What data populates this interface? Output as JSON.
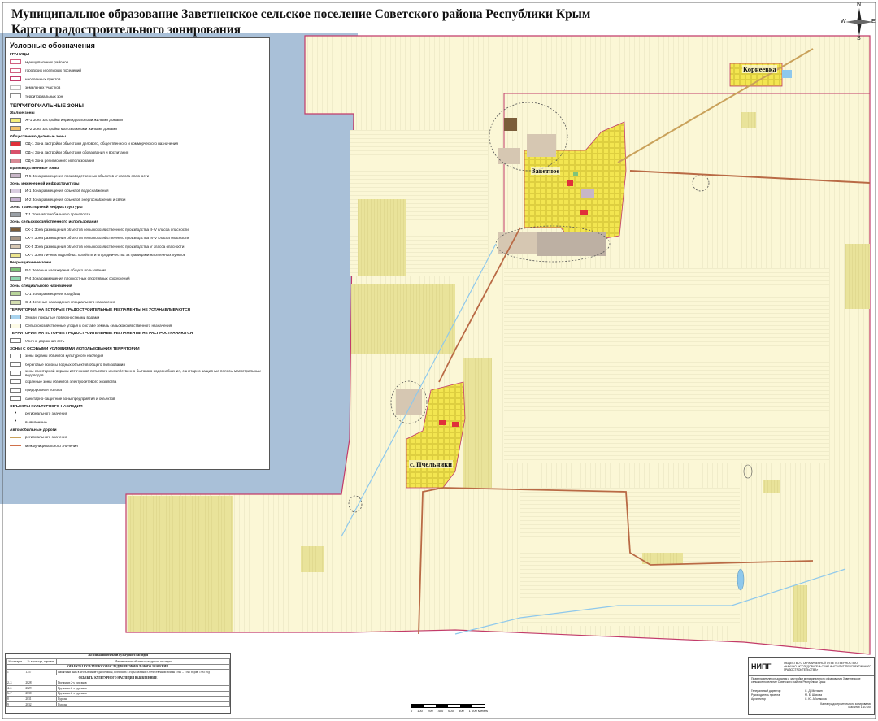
{
  "title": {
    "line1": "Муниципальное образование Заветненское сельское поселение Советского района Республики Крым",
    "line2": "Карта градостроительного зонирования"
  },
  "compass": {
    "n": "N",
    "e": "E",
    "s": "S",
    "w": "W"
  },
  "places": {
    "zavetnoe": "Заветное",
    "pchelniki": "с. Пчельники",
    "korneevka": "Корнеевка"
  },
  "legend": {
    "heading": "Условные обозначения",
    "borders_title": "ГРАНИЦЫ",
    "borders": [
      {
        "label": "муниципальных районов",
        "color": "#d06080"
      },
      {
        "label": "городских и сельских поселений",
        "color": "#d06080"
      },
      {
        "label": "населенных пунктов",
        "color": "#c23b6a"
      },
      {
        "label": "земельных участков",
        "color": "#bbbbbb"
      },
      {
        "label": "территориальных зон",
        "color": "#888888"
      }
    ],
    "terr_zones_title": "ТЕРРИТОРИАЛЬНЫЕ ЗОНЫ",
    "residential_title": "Жилые зоны",
    "residential": [
      {
        "label": "Ж-1  Зона застройки индивидуальными жилыми домами",
        "color": "#f6ef7a"
      },
      {
        "label": "Ж-2  Зона застройки малоэтажными жилыми домами",
        "color": "#f3c36b"
      }
    ],
    "public_title": "Общественно-деловые зоны",
    "public": [
      {
        "label": "ОД-1  Зона застройки объектами делового, общественного и коммерческого назначения",
        "color": "#e0303a"
      },
      {
        "label": "ОД-4  Зона застройки объектами образования и воспитания",
        "color": "#d9506a"
      },
      {
        "label": "ОД-6  Зона религиозного использования",
        "color": "#d88a95"
      }
    ],
    "industrial_title": "Производственные зоны",
    "industrial": [
      {
        "label": "П-5  Зона размещения производственных объектов V класса опасности",
        "color": "#c7b6c7"
      }
    ],
    "engineering_title": "Зоны инженерной инфраструктуры",
    "engineering": [
      {
        "label": "И-1  Зона размещения объектов водоснабжения",
        "color": "#d9cde0"
      },
      {
        "label": "И-2  Зона размещения объектов энергоснабжения и связи",
        "color": "#c8b4d2"
      }
    ],
    "transport_title": "Зоны транспортной инфраструктуры",
    "transport": [
      {
        "label": "Т-1  Зона автомобильного транспорта",
        "color": "#9aa0a6"
      }
    ],
    "agri_title": "Зоны сельскохозяйственного использования",
    "agri": [
      {
        "label": "СХ-2  Зона размещения объектов сельскохозяйственного производства II- V класса опасности",
        "color": "#7b5d3a"
      },
      {
        "label": "СХ-4  Зона размещения объектов сельскохозяйственного производства IV-V класса опасности",
        "color": "#a89785"
      },
      {
        "label": "СХ-5  Зона размещения объектов сельскохозяйственного производства V класса опасности",
        "color": "#d6c7b2"
      },
      {
        "label": "СХ-7  Зона личных подсобных хозяйств и огородничества за границами населенных пунктов",
        "color": "#ece58f"
      }
    ],
    "recreation_title": "Рекреационные зоны",
    "recreation": [
      {
        "label": "Р-1  Зеленые насаждения общего пользования",
        "color": "#7fc47a"
      },
      {
        "label": "Р-4  Зона размещения плоскостных спортивных сооружений",
        "color": "#8fd6b0"
      }
    ],
    "special_title": "Зоны специального назначения",
    "special": [
      {
        "label": "С-1  Зона размещения кладбищ",
        "color": "#b8d49a"
      },
      {
        "label": "С-4  Зеленые насаждения специального назначения",
        "color": "#d3ddb0"
      }
    ],
    "no_regs_title": "ТЕРРИТОРИИ, НА КОТОРЫЕ ГРАДОСТРОИТЕЛЬНЫЕ РЕГЛАМЕНТЫ НЕ УСТАНАВЛИВАЮТСЯ",
    "no_regs": [
      {
        "label": "Земли, покрытые поверхностными водами",
        "color": "#a8d3ee"
      },
      {
        "label": "Сельскохозяйственные угодья в составе земель сельскохозяйственного назначения",
        "color": "#fdfbe6"
      }
    ],
    "no_apply_title": "ТЕРРИТОРИИ, НА КОТОРЫЕ ГРАДОСТРОИТЕЛЬНЫЕ РЕГЛАМЕНТЫ НЕ РАСПРОСТРАНЯЮТСЯ",
    "no_apply": [
      {
        "label": "Улично-дорожная сеть",
        "color": "#ffffff"
      }
    ],
    "special_cond_title": "ЗОНЫ С ОСОБЫМИ УСЛОВИЯМИ ИСПОЛЬЗОВАНИЯ ТЕРРИТОРИИ",
    "special_cond": [
      {
        "label": "зоны охраны объектов культурного наследия",
        "color": "#ffffff"
      },
      {
        "label": "береговые полосы водных объектов общего пользования",
        "color": "#ffffff"
      },
      {
        "label": "зоны санитарной охраны источников питьевого и хозяйственно-бытового водоснабжения, санитарно-защитные полосы магистральных водоводов",
        "color": "#ffffff"
      },
      {
        "label": "охранные зоны объектов электросетевого хозяйства",
        "color": "#ffffff"
      },
      {
        "label": "придорожная полоса",
        "color": "#ffffff"
      },
      {
        "label": "санитарно-защитные зоны предприятий и объектов",
        "color": "#ffffff"
      }
    ],
    "heritage_title": "ОБЪЕКТЫ КУЛЬТУРНОГО НАСЛЕДИЯ",
    "heritage": [
      {
        "label": "регионального значения"
      },
      {
        "label": "выявленные"
      }
    ],
    "roads_title": "Автомобильные дороги",
    "roads": [
      {
        "label": "регионального значения",
        "color": "#c9a15a"
      },
      {
        "label": "межмуниципального значения",
        "color": "#d0704a"
      }
    ]
  },
  "heritage_table": {
    "caption": "Экспликация объектов культурного наследия",
    "headers": [
      "№ на карте",
      "№ в реестре, перечне",
      "Наименование объекта культурного наследия"
    ],
    "section1": "ОБЪЕКТЫ КУЛЬТУРНОГО НАСЛЕДИЯ РЕГИОНАЛЬНОГО ЗНАЧЕНИЯ",
    "rows1": [
      [
        "1",
        "1757",
        "Памятный знак в честь воинов-односельчан, погибших в годы Великой Отечественной войны 1941 – 1945 годов, 1985 год"
      ]
    ],
    "section2": "ОБЪЕКТЫ КУЛЬТУРНОГО НАСЛЕДИЯ ВЫЯВЛЕННЫЕ",
    "rows2": [
      [
        "2–3",
        "2028",
        "Группа из 2-х курганов"
      ],
      [
        "4–5",
        "2029",
        "Группа из 2-х курганов"
      ],
      [
        "6–7",
        "2030",
        "Группа из 2-х курганов"
      ],
      [
        "8",
        "2031",
        "Курган"
      ],
      [
        "9",
        "2032",
        "Курган"
      ]
    ]
  },
  "scale": {
    "ticks": [
      "0",
      "100",
      "200",
      "400",
      "600",
      "800",
      "1 000 Meters"
    ]
  },
  "stamp": {
    "org": "ОБЩЕСТВО С ОГРАНИЧЕННОЙ ОТВЕТСТВЕННОСТЬЮ «НАУЧНО-ИССЛЕДОВАТЕЛЬСКИЙ ИНСТИТУТ ПЕРСПЕКТИВНОГО ГРАДОСТРОИТЕЛЬСТВА»",
    "logo": "НИПГ",
    "project": "Правила землепользования и застройки муниципального образования Заветненское сельское поселение Советского района Республики Крым",
    "roles": [
      "Генеральный директор",
      "Руководитель проекта",
      "Архитектор"
    ],
    "names": [
      "С. Д. Митягин",
      "М. Б. Шахова",
      "С. Ю. Аболакова"
    ],
    "sheet": "Карта градостроительного зонирования",
    "scale_note": "Масштаб 1:10 000"
  },
  "colors": {
    "sea": "#a9c0d8",
    "field": "#fbf7d6",
    "settlement": "#f3e650",
    "border": "#c23b6a",
    "road_regional": "#c9a15a",
    "road_inter": "#b96a45",
    "water": "#8ec8ec",
    "sx7": "#ece58f"
  }
}
